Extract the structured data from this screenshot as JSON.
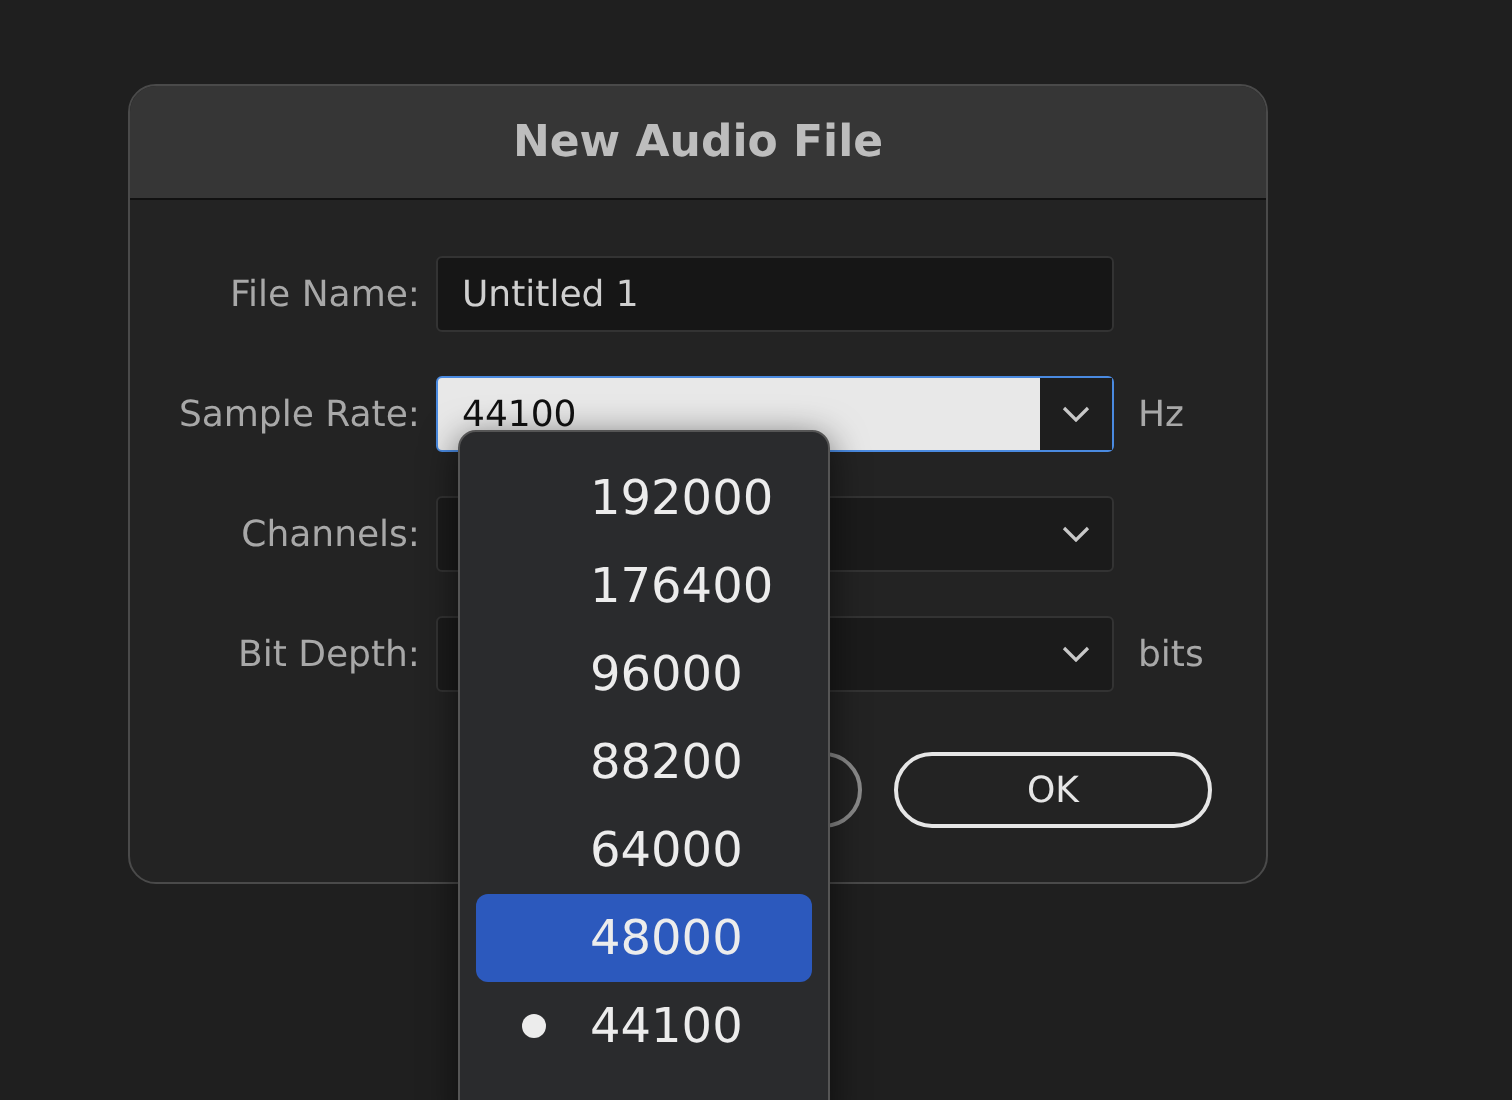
{
  "dialog": {
    "title": "New Audio File",
    "fields": [
      {
        "kind": "text",
        "label": "File Name:",
        "value": "Untitled 1"
      },
      {
        "kind": "select",
        "label": "Sample Rate:",
        "value": "44100",
        "unit": "Hz",
        "open": true
      },
      {
        "kind": "select",
        "label": "Channels:",
        "open": false
      },
      {
        "kind": "select",
        "label": "Bit Depth:",
        "unit": "bits",
        "open": false
      }
    ],
    "buttons": [
      {
        "label": "OK"
      }
    ]
  },
  "menu": {
    "items": [
      {
        "label": "192000",
        "highlighted": false,
        "checked": false
      },
      {
        "label": "176400",
        "highlighted": false,
        "checked": false
      },
      {
        "label": "96000",
        "highlighted": false,
        "checked": false
      },
      {
        "label": "88200",
        "highlighted": false,
        "checked": false
      },
      {
        "label": "64000",
        "highlighted": false,
        "checked": false
      },
      {
        "label": "48000",
        "highlighted": true,
        "checked": false
      },
      {
        "label": "44100",
        "highlighted": false,
        "checked": true
      }
    ]
  }
}
